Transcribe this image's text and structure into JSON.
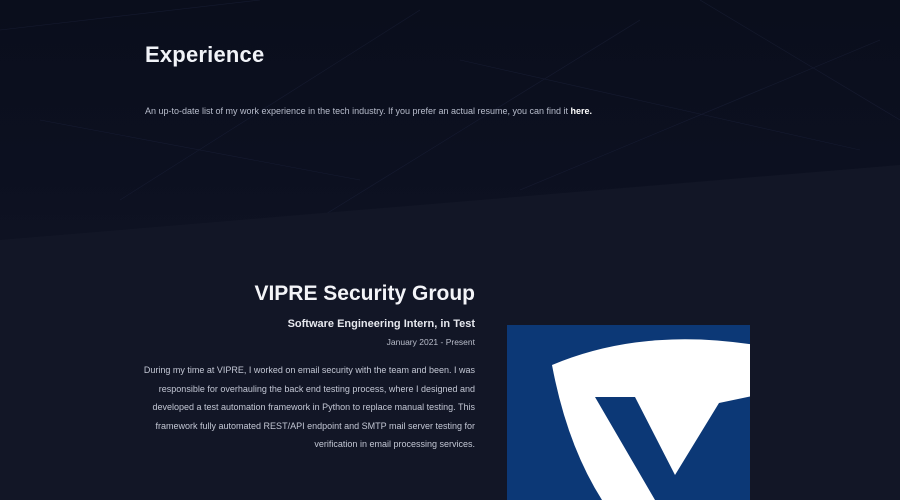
{
  "section": {
    "title": "Experience",
    "intro_text": "An up-to-date list of my work experience in the tech industry. If you prefer an actual resume, you can find it ",
    "intro_link": "here."
  },
  "experience": [
    {
      "company": "VIPRE Security Group",
      "role": "Software Engineering Intern, in Test",
      "dates": "January 2021 - Present",
      "description": "During my time at VIPRE, I worked on email security with the team and been. I was responsible for overhauling the back end testing process, where I designed and developed a test automation framework in Python to replace manual testing. This framework fully automated REST/API endpoint and SMTP mail server testing for verification in email processing services.",
      "logo": "vipre-shield-logo",
      "logo_colors": {
        "background": "#0c3876",
        "shield": "#ffffff",
        "mark": "#0c3876"
      }
    }
  ]
}
